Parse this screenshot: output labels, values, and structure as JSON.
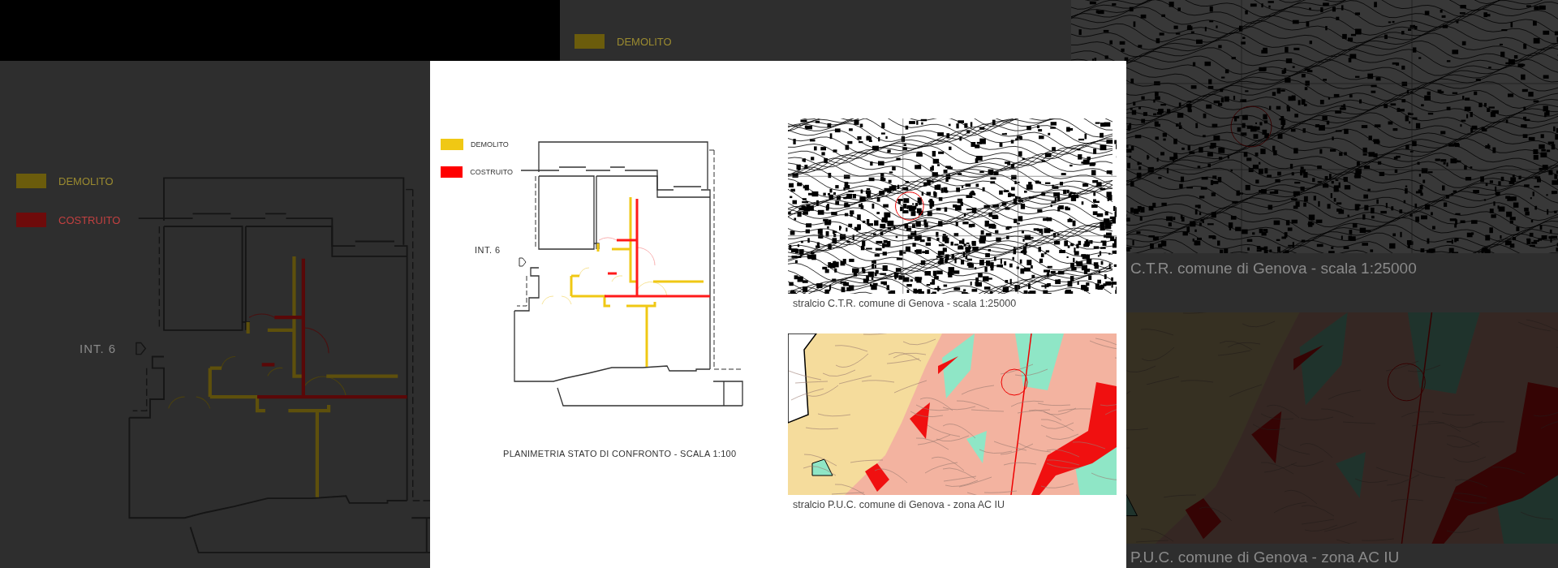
{
  "background": {
    "top_legend": {
      "label": "DEMOLITO",
      "color": "#6b5c0c"
    },
    "legend": [
      {
        "label": "DEMOLITO",
        "color": "#6b5c0c"
      },
      {
        "label": "COSTRUITO",
        "color": "#6e0b0b"
      }
    ],
    "entrance_label": "INT. 6",
    "map_captions": [
      "C.T.R.  comune di Genova - scala 1:25000",
      "P.U.C. comune di Genova - zona AC IU"
    ]
  },
  "sheet": {
    "legend": [
      {
        "label": "DEMOLITO",
        "color": "#f0c814"
      },
      {
        "label": "COSTRUITO",
        "color": "#ff0000"
      }
    ],
    "entrance_label": "INT. 6",
    "plan_caption": "PLANIMETRIA STATO DI CONFRONTO - SCALA 1:100",
    "maps": [
      {
        "kind": "topographic",
        "caption": "stralcio C.T.R.  comune di Genova - scala 1:25000"
      },
      {
        "kind": "zoning",
        "caption": "stralcio P.U.C. comune di Genova - zona AC IU"
      }
    ]
  }
}
